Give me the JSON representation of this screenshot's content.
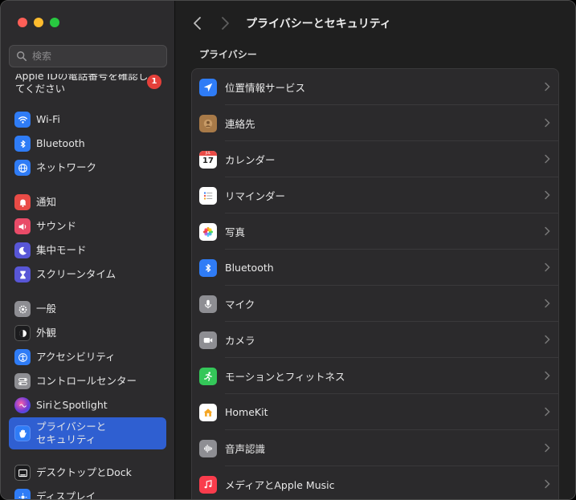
{
  "window": {
    "title": "プライバシーとセキュリティ"
  },
  "sidebar": {
    "search_placeholder": "検索",
    "apple_id_text": "Apple IDの電話番号を確認してください",
    "apple_id_badge": "1",
    "items": [
      {
        "label": "Wi-Fi",
        "icon": "wifi-icon",
        "color": "#2f7cf6"
      },
      {
        "label": "Bluetooth",
        "icon": "bluetooth-icon",
        "color": "#2f7cf6"
      },
      {
        "label": "ネットワーク",
        "icon": "globe-icon",
        "color": "#2f7cf6"
      },
      {
        "label": "通知",
        "icon": "bell-icon",
        "color": "#e94b46"
      },
      {
        "label": "サウンド",
        "icon": "speaker-icon",
        "color": "#e94b68"
      },
      {
        "label": "集中モード",
        "icon": "moon-icon",
        "color": "#5856d6"
      },
      {
        "label": "スクリーンタイム",
        "icon": "hourglass-icon",
        "color": "#5856d6"
      },
      {
        "label": "一般",
        "icon": "gear-icon",
        "color": "#8e8e93"
      },
      {
        "label": "外観",
        "icon": "appearance-icon",
        "color": "#1c1c1e"
      },
      {
        "label": "アクセシビリティ",
        "icon": "accessibility-icon",
        "color": "#2f7cf6"
      },
      {
        "label": "コントロールセンター",
        "icon": "toggles-icon",
        "color": "#8e8e93"
      },
      {
        "label": "SiriとSpotlight",
        "icon": "siri-icon",
        "color": "#5b3fd6"
      },
      {
        "label": "プライバシーとセキュリティ",
        "line1": "プライバシーと",
        "line2": "セキュリティ",
        "icon": "hand-icon",
        "color": "#2f7cf6",
        "selected": true
      },
      {
        "label": "デスクトップとDock",
        "icon": "desktop-icon",
        "color": "#1c1c1e"
      },
      {
        "label": "ディスプレイ",
        "icon": "display-icon",
        "color": "#2f7cf6"
      }
    ]
  },
  "main": {
    "title": "プライバシーとセキュリティ",
    "section": "プライバシー",
    "rows": [
      {
        "label": "位置情報サービス",
        "icon": "location-arrow-icon",
        "color": "#2f7cf6"
      },
      {
        "label": "連絡先",
        "icon": "contacts-icon",
        "color": "#a87a48"
      },
      {
        "label": "カレンダー",
        "icon": "calendar-icon",
        "color": "#ffffff",
        "calendar_month": "JUL",
        "calendar_day": "17"
      },
      {
        "label": "リマインダー",
        "icon": "reminders-icon",
        "color": "#ffffff"
      },
      {
        "label": "写真",
        "icon": "photos-icon",
        "color": "#ffffff"
      },
      {
        "label": "Bluetooth",
        "icon": "bluetooth-icon",
        "color": "#2f7cf6"
      },
      {
        "label": "マイク",
        "icon": "microphone-icon",
        "color": "#8e8e93"
      },
      {
        "label": "カメラ",
        "icon": "camera-icon",
        "color": "#8e8e93"
      },
      {
        "label": "モーションとフィットネス",
        "icon": "running-icon",
        "color": "#34c759"
      },
      {
        "label": "HomeKit",
        "icon": "home-icon",
        "color": "#ffffff"
      },
      {
        "label": "音声認識",
        "icon": "waveform-icon",
        "color": "#8e8e93"
      },
      {
        "label": "メディアとApple Music",
        "icon": "music-note-icon",
        "color": "#fa3c4c"
      }
    ]
  }
}
